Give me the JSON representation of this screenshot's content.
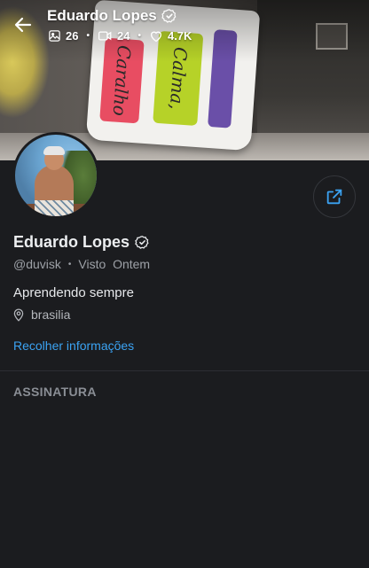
{
  "header": {
    "name": "Eduardo Lopes",
    "stats": {
      "media": "26",
      "videos": "24",
      "likes": "4.7K"
    }
  },
  "cover": {
    "mug_words": [
      "Caralho",
      "Calma,",
      ""
    ],
    "mug_colors": [
      "#e84d62",
      "#b6d228",
      "#6a4fa8"
    ]
  },
  "profile": {
    "name": "Eduardo Lopes",
    "username": "@duvisk",
    "separator": "•",
    "last_seen": "Visto  Ontem",
    "bio": "Aprendendo sempre",
    "location": "brasilia",
    "collapse_link": "Recolher informações"
  },
  "section": {
    "title": "ASSINATURA"
  },
  "colors": {
    "accent": "#3ba3f3",
    "background": "#1b1c1f"
  }
}
